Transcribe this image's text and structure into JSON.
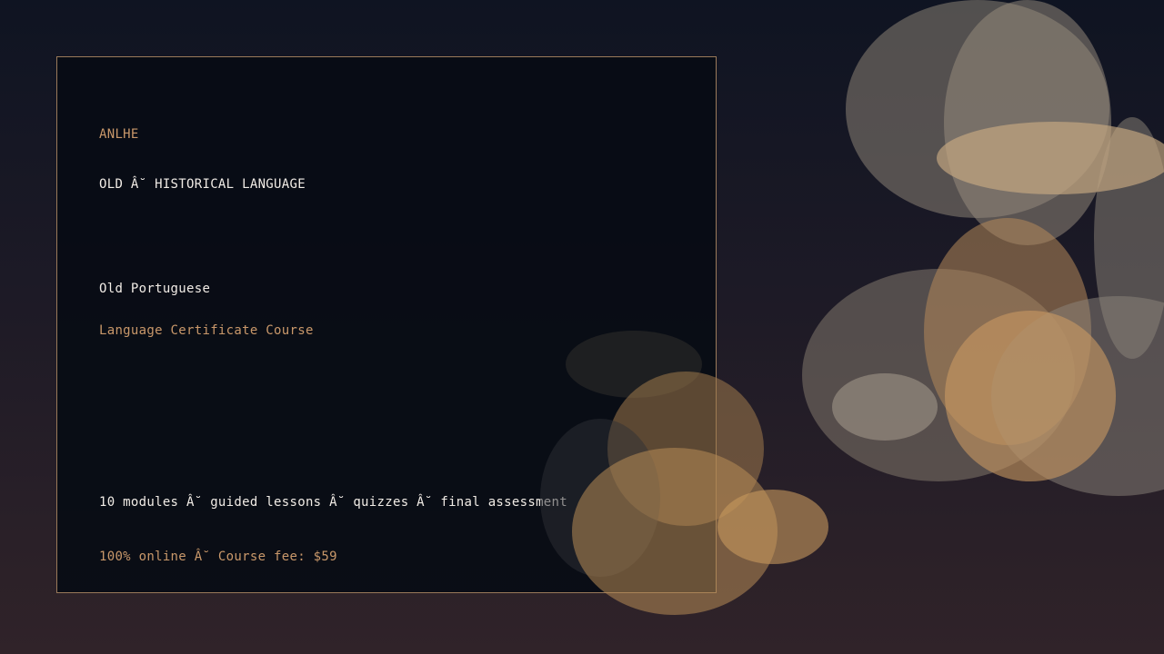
{
  "card": {
    "brand": "ANLHE",
    "category": "OLD Â˘ HISTORICAL LANGUAGE",
    "course_name": "Old Portuguese",
    "course_type": "Language Certificate Course",
    "details": "10 modules Â˘ guided lessons Â˘ quizzes Â˘ final assessment",
    "pricing": "100% online Â˘ Course fee: $59"
  },
  "colors": {
    "accent": "#c9986a",
    "text": "#f1ece6",
    "border": "#9a7a5a",
    "card_bg": "#080c14"
  }
}
